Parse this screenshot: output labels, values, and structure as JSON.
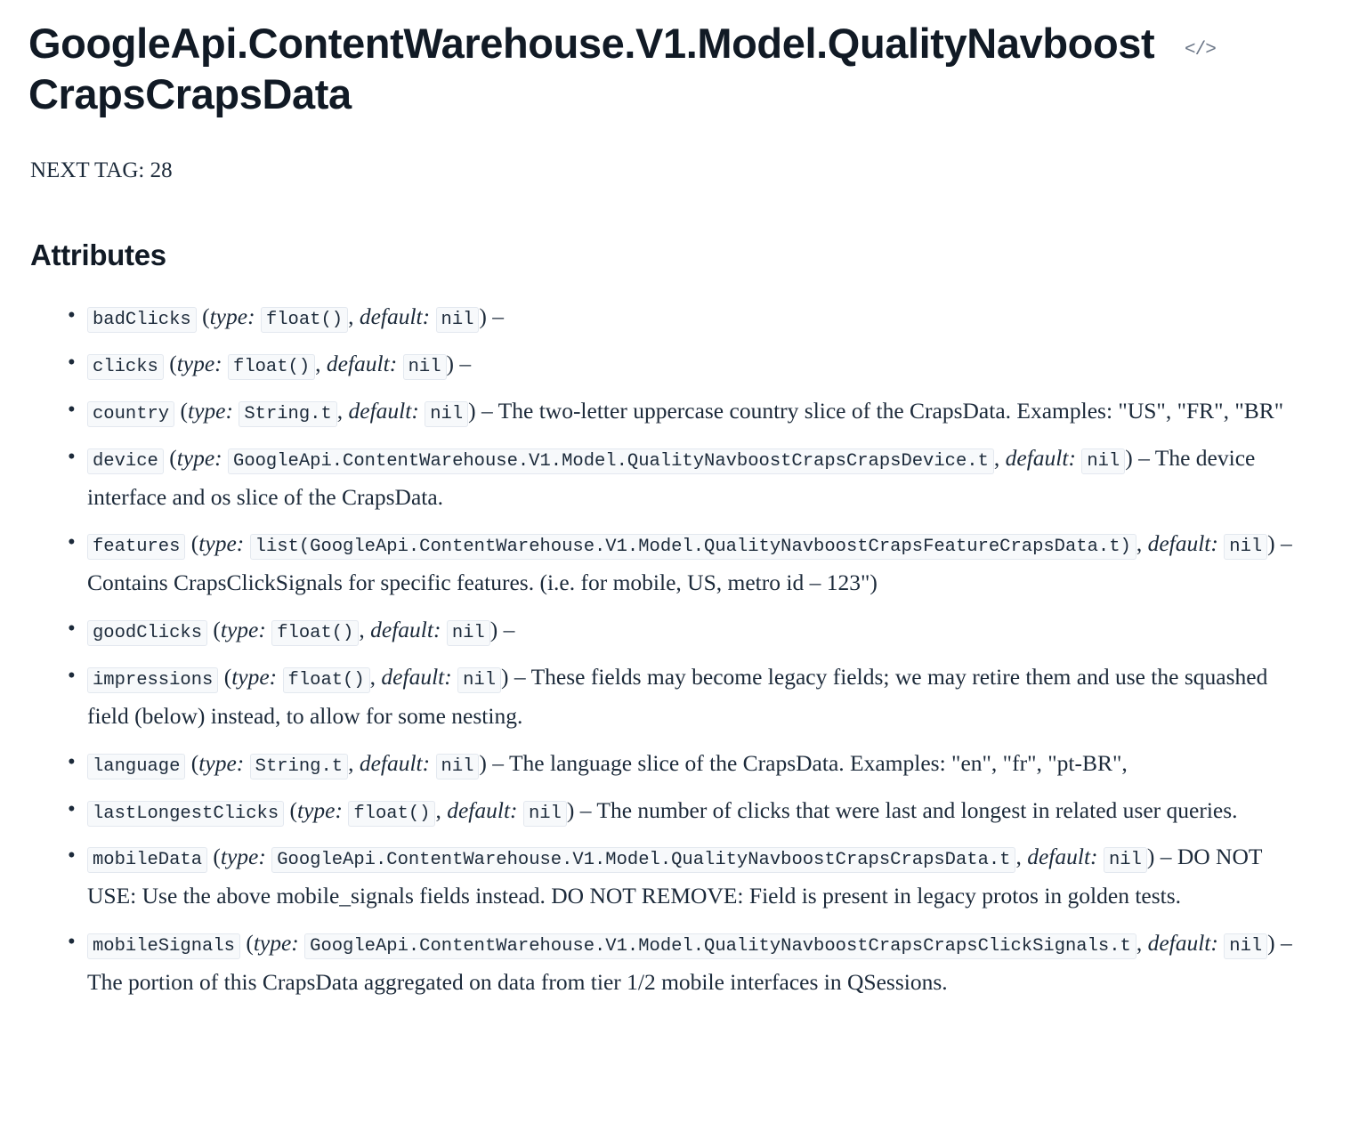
{
  "page": {
    "title": "GoogleApi.ContentWarehouse.V1.Model.QualityNavboostCrapsCrapsData",
    "source_icon": "code-icon",
    "source_icon_glyph": "</>",
    "next_tag": "NEXT TAG: 28",
    "section_heading": "Attributes"
  },
  "labels": {
    "type": "type:",
    "default": "default:",
    "open_paren": "(",
    "close_paren": ")",
    "comma": ",",
    "dash": "–"
  },
  "colors": {
    "text": "#1c2a3a",
    "heading": "#111a25",
    "chip_bg": "#f7f9fb",
    "chip_border": "#e3e8ef",
    "icon": "#6b7687"
  },
  "attributes": [
    {
      "name": "badClicks",
      "type": "float()",
      "default": "nil",
      "description": ""
    },
    {
      "name": "clicks",
      "type": "float()",
      "default": "nil",
      "description": ""
    },
    {
      "name": "country",
      "type": "String.t",
      "default": "nil",
      "description": "The two-letter uppercase country slice of the CrapsData. Examples: \"US\", \"FR\", \"BR\""
    },
    {
      "name": "device",
      "type": "GoogleApi.ContentWarehouse.V1.Model.QualityNavboostCrapsCrapsDevice.t",
      "default": "nil",
      "description": "The device interface and os slice of the CrapsData."
    },
    {
      "name": "features",
      "type": "list(GoogleApi.ContentWarehouse.V1.Model.QualityNavboostCrapsFeatureCrapsData.t)",
      "default": "nil",
      "description": "Contains CrapsClickSignals for specific features. (i.e. for mobile, US, metro id – 123\")"
    },
    {
      "name": "goodClicks",
      "type": "float()",
      "default": "nil",
      "description": ""
    },
    {
      "name": "impressions",
      "type": "float()",
      "default": "nil",
      "description": "These fields may become legacy fields; we may retire them and use the squashed field (below) instead, to allow for some nesting."
    },
    {
      "name": "language",
      "type": "String.t",
      "default": "nil",
      "description": "The language slice of the CrapsData. Examples: \"en\", \"fr\", \"pt-BR\","
    },
    {
      "name": "lastLongestClicks",
      "type": "float()",
      "default": "nil",
      "description": "The number of clicks that were last and longest in related user queries."
    },
    {
      "name": "mobileData",
      "type": "GoogleApi.ContentWarehouse.V1.Model.QualityNavboostCrapsCrapsData.t",
      "default": "nil",
      "description": "DO NOT USE: Use the above mobile_signals fields instead. DO NOT REMOVE: Field is present in legacy protos in golden tests."
    },
    {
      "name": "mobileSignals",
      "type": "GoogleApi.ContentWarehouse.V1.Model.QualityNavboostCrapsCrapsClickSignals.t",
      "default": "nil",
      "description": "The portion of this CrapsData aggregated on data from tier 1/2 mobile interfaces in QSessions."
    }
  ]
}
